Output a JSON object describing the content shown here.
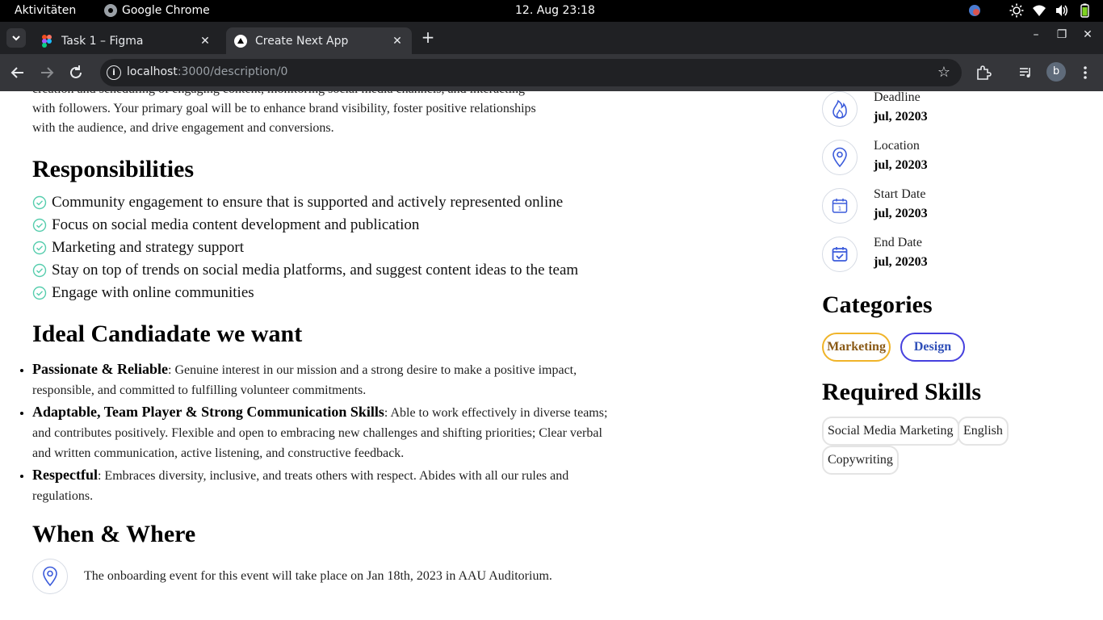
{
  "system_bar": {
    "activities": "Aktivitäten",
    "app_name": "Google Chrome",
    "clock": "12. Aug  23:18"
  },
  "browser": {
    "tabs": [
      {
        "title": "Task 1 – Figma",
        "active": false
      },
      {
        "title": "Create Next App",
        "active": true
      }
    ],
    "url_host": "localhost",
    "url_path": ":3000/description/0",
    "profile_initial": "b"
  },
  "content": {
    "intro_lines": [
      "creation and scheduling of engaging content, monitoring social media channels, and interacting",
      "with followers. Your primary goal will be to enhance brand visibility, foster positive relationships",
      "with the audience, and drive engagement and conversions."
    ],
    "responsibilities_title": "Responsibilities",
    "responsibilities": [
      "Community engagement to ensure that is supported and actively represented online",
      "Focus on social media content development and publication",
      "Marketing and strategy support",
      "Stay on top of trends on social media platforms, and suggest content ideas to the team",
      "Engage with online communities"
    ],
    "ideal_title": "Ideal Candiadate we want",
    "ideal": [
      {
        "trait": "Passionate & Reliable",
        "desc": ": Genuine interest in our mission and a strong desire to make a positive impact, responsible, and committed to fulfilling volunteer commitments."
      },
      {
        "trait": "Adaptable, Team Player & Strong Communication Skills",
        "desc": ": Able to work effectively in diverse teams; and contributes positively. Flexible and open to embracing new challenges and shifting priorities; Clear verbal and written communication, active listening, and constructive feedback."
      },
      {
        "trait": "Respectful",
        "desc": ": Embraces diversity, inclusive, and treats others with respect. Abides with all our rules and regulations."
      }
    ],
    "when_title": "When & Where",
    "when_text": "The onboarding event for this event will take place on Jan 18th, 2023 in AAU Auditorium."
  },
  "sidebar": {
    "items": [
      {
        "label": "Deadline",
        "value": "jul, 20203",
        "icon": "fire-icon"
      },
      {
        "label": "Location",
        "value": "jul, 20203",
        "icon": "location-pin-icon"
      },
      {
        "label": "Start Date",
        "value": "jul, 20203",
        "icon": "calendar-icon"
      },
      {
        "label": "End Date",
        "value": "jul, 20203",
        "icon": "calendar-check-icon"
      }
    ],
    "categories_title": "Categories",
    "categories": [
      "Marketing",
      "Design"
    ],
    "skills_title": "Required Skills",
    "skills": [
      "Social Media Marketing",
      "English",
      "Copywriting"
    ]
  },
  "colors": {
    "icon_blue": "#3b5bdb",
    "check_green": "#56cdad",
    "marketing_border": "#f0b429",
    "design_border": "#4640de"
  }
}
